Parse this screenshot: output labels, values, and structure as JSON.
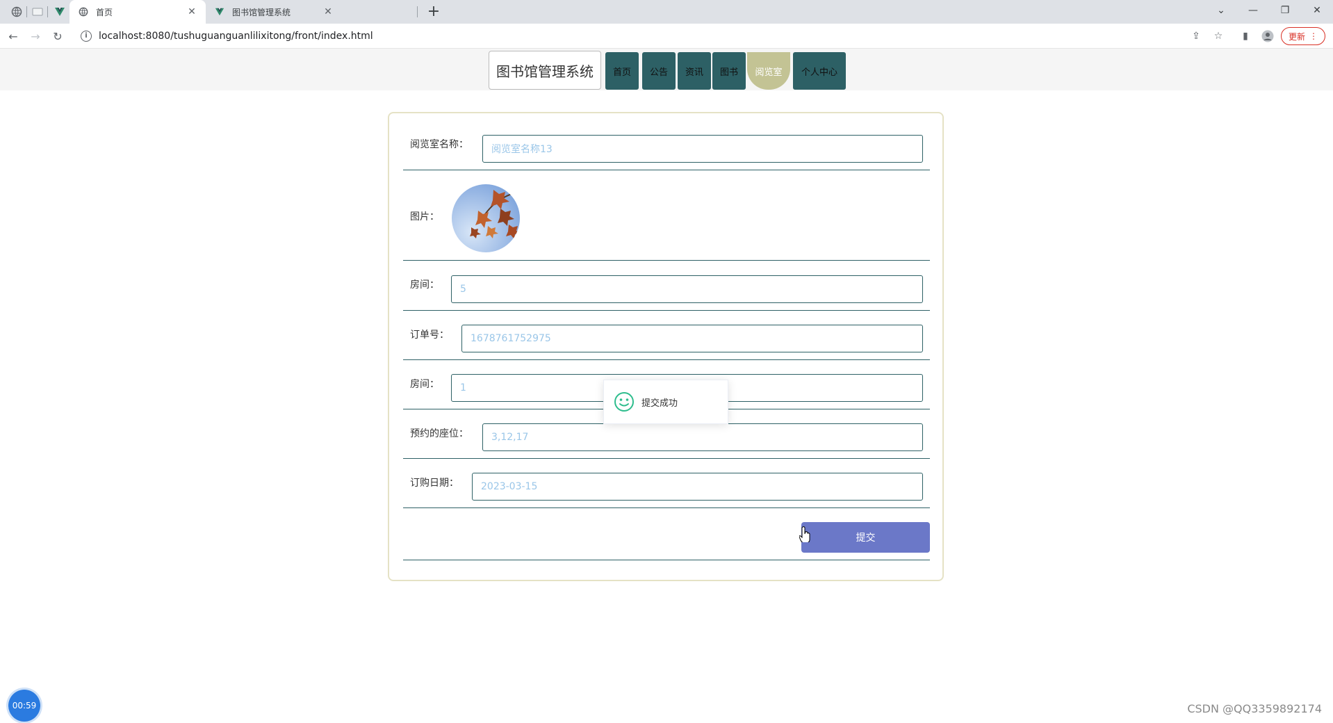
{
  "browser": {
    "tabs": [
      {
        "title": "首页",
        "active": true,
        "favicon": "globe-icon"
      },
      {
        "title": "图书馆管理系统",
        "active": false,
        "favicon": "vue-icon"
      }
    ],
    "url": "localhost:8080/tushuguanguanlilixitong/front/index.html",
    "update_label": "更新"
  },
  "site": {
    "title": "图书馆管理系统",
    "nav": [
      {
        "label": "首页",
        "active": false
      },
      {
        "label": "公告",
        "active": false
      },
      {
        "label": "资讯",
        "active": false
      },
      {
        "label": "图书",
        "active": false
      },
      {
        "label": "阅览室",
        "active": true
      },
      {
        "label": "个人中心",
        "active": false
      }
    ]
  },
  "form": {
    "fields": [
      {
        "label": "阅览室名称：",
        "value": "阅览室名称13"
      },
      {
        "label": "图片：",
        "value": "maple-leaves-image"
      },
      {
        "label": "房间：",
        "value": "5"
      },
      {
        "label": "订单号：",
        "value": "1678761752975"
      },
      {
        "label": "房间：",
        "value": "1"
      },
      {
        "label": "预约的座位：",
        "value": "3,12,17"
      },
      {
        "label": "订购日期：",
        "value": "2023-03-15"
      }
    ],
    "submit_label": "提交"
  },
  "toast": {
    "message": "提交成功",
    "icon": "smile-icon",
    "color": "#2ebd8d"
  },
  "overlay": {
    "timer": "00:59",
    "watermark": "CSDN @QQ3359892174"
  },
  "colors": {
    "nav_bg": "#2d6065",
    "nav_active": "#c3c394",
    "submit": "#6b78c8",
    "input_text": "#9ac6e8"
  }
}
